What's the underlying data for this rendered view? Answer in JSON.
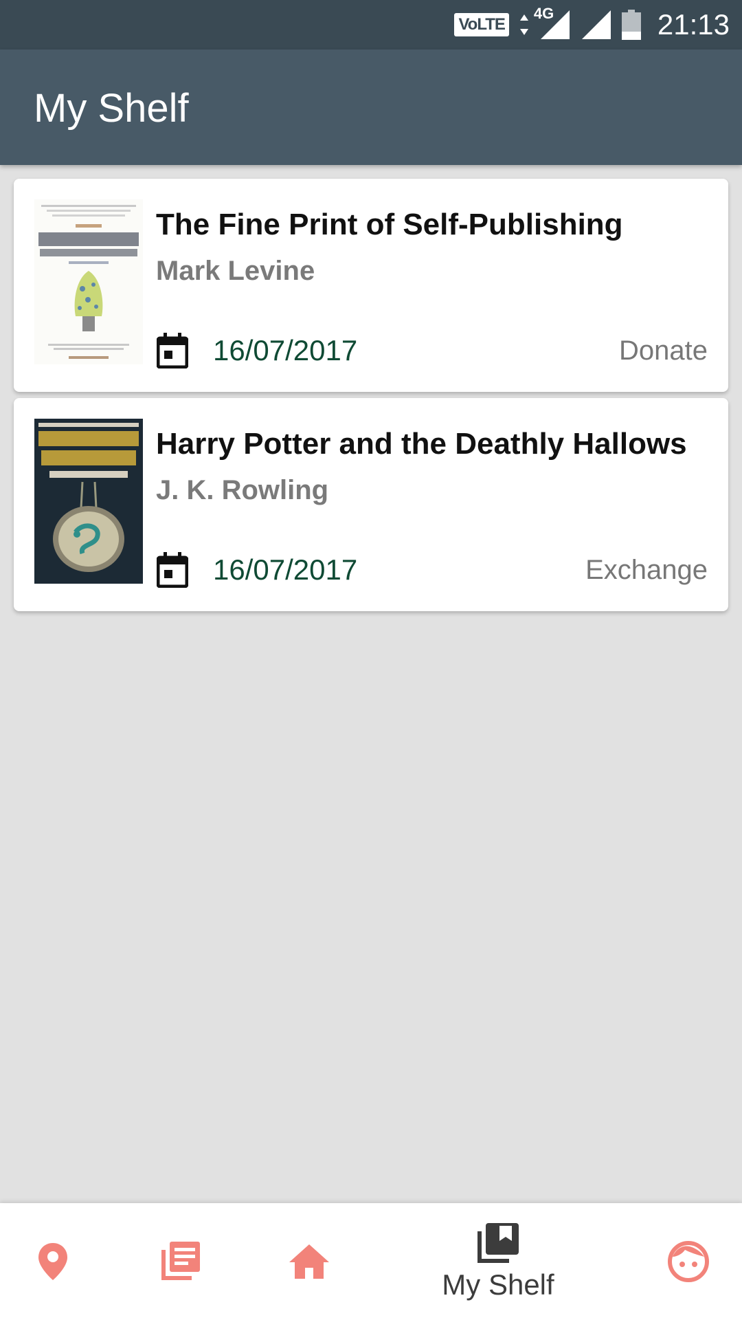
{
  "status_bar": {
    "volte": "VoLTE",
    "network": "4G",
    "time": "21:13"
  },
  "app_bar": {
    "title": "My Shelf"
  },
  "books": [
    {
      "title": "The Fine Print of Self-Publishing",
      "author": "Mark Levine",
      "date": "16/07/2017",
      "action": "Donate"
    },
    {
      "title": "Harry Potter and the Deathly Hallows",
      "author": "J. K. Rowling",
      "date": "16/07/2017",
      "action": "Exchange"
    }
  ],
  "bottom_nav": {
    "items": [
      {
        "icon": "location-pin-icon",
        "label": ""
      },
      {
        "icon": "library-books-icon",
        "label": ""
      },
      {
        "icon": "home-icon",
        "label": ""
      },
      {
        "icon": "my-shelf-icon",
        "label": "My Shelf"
      },
      {
        "icon": "profile-face-icon",
        "label": ""
      }
    ]
  },
  "colors": {
    "status_bar": "#3a4a54",
    "app_bar": "#485a67",
    "background": "#e1e1e1",
    "accent_nav": "#f2837a",
    "date_text": "#0f4a34"
  }
}
